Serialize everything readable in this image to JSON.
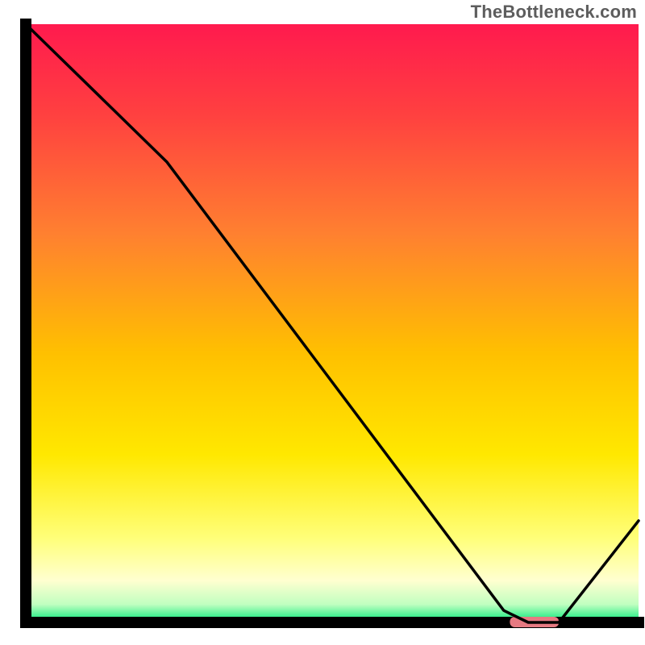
{
  "watermark": "TheBottleneck.com",
  "chart_data": {
    "type": "line",
    "title": "",
    "xlabel": "",
    "ylabel": "",
    "xlim": [
      0,
      100
    ],
    "ylim": [
      0,
      100
    ],
    "series": [
      {
        "name": "bottleneck-curve",
        "x": [
          0,
          4,
          23,
          78,
          82,
          87,
          100
        ],
        "y": [
          100,
          96,
          77,
          2,
          0,
          0,
          17
        ],
        "color": "#000000"
      }
    ],
    "marker": {
      "name": "optimal-region",
      "x_start": 79,
      "x_end": 87,
      "y": 0,
      "color": "#e67a82"
    },
    "background_gradient": {
      "stops": [
        {
          "offset": 0.0,
          "color": "#ff1a4e"
        },
        {
          "offset": 0.15,
          "color": "#ff4040"
        },
        {
          "offset": 0.35,
          "color": "#ff8030"
        },
        {
          "offset": 0.55,
          "color": "#ffc000"
        },
        {
          "offset": 0.72,
          "color": "#ffe800"
        },
        {
          "offset": 0.86,
          "color": "#ffff7a"
        },
        {
          "offset": 0.93,
          "color": "#ffffd0"
        },
        {
          "offset": 0.97,
          "color": "#c0ffc0"
        },
        {
          "offset": 1.0,
          "color": "#00e878"
        }
      ]
    },
    "axes_color": "#000000"
  }
}
